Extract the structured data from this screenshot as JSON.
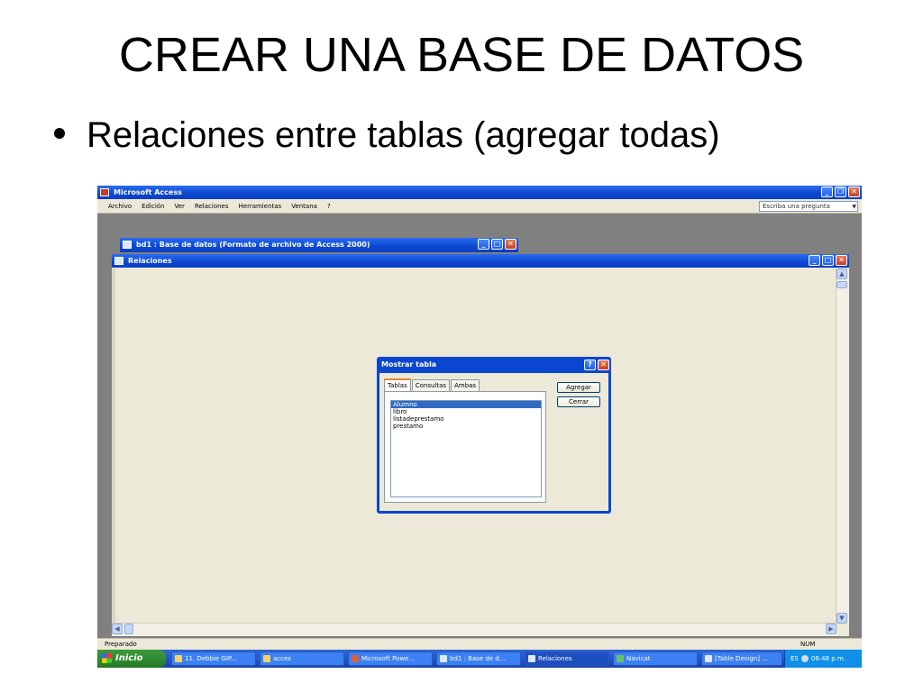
{
  "slide": {
    "title": "CREAR UNA BASE DE DATOS",
    "bullet": "Relaciones entre tablas (agregar todas)"
  },
  "app": {
    "title": "Microsoft Access",
    "menu": [
      "Archivo",
      "Edición",
      "Ver",
      "Relaciones",
      "Herramientas",
      "Ventana",
      "?"
    ],
    "help_placeholder": "Escriba una pregunta"
  },
  "db_window": {
    "title": "bd1 : Base de datos (Formato de archivo de Access 2000)"
  },
  "relations_window": {
    "title": "Relaciones"
  },
  "dialog": {
    "title": "Mostrar tabla",
    "tabs": [
      "Tablas",
      "Consultas",
      "Ambas"
    ],
    "tables": [
      "Alumno",
      "libro",
      "listadeprestamo",
      "prestamo"
    ],
    "selected_index": 0,
    "add_button": "Agregar",
    "close_button": "Cerrar"
  },
  "status": {
    "left": "Preparado",
    "right": "NUM"
  },
  "taskbar": {
    "start": "Inicio",
    "items": [
      "11. Debbie GIP...",
      "acces",
      "Microsoft Powe...",
      "bd1 : Base de d...",
      "Relaciones",
      "Navicat",
      "[Table Design] ..."
    ],
    "active_index": 4,
    "language": "ES",
    "clock": "06:48 p.m."
  }
}
